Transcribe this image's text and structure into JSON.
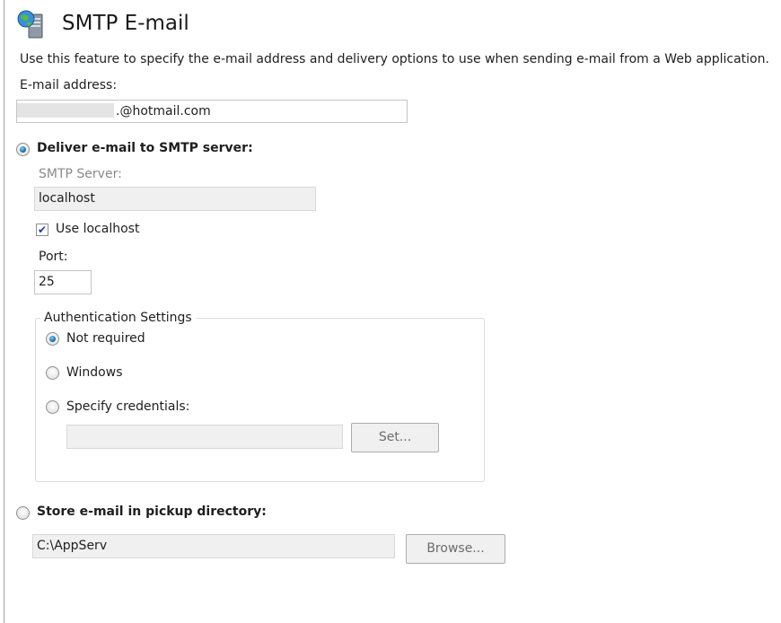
{
  "header": {
    "title": "SMTP E-mail",
    "icon": "globe-server-icon"
  },
  "description": "Use this feature to specify the e-mail address and delivery options to use when sending e-mail from a Web application.",
  "email": {
    "label": "E-mail address:",
    "value_suffix": ".@hotmail.com"
  },
  "smtp": {
    "option_label": "Deliver e-mail to SMTP server:",
    "selected": true,
    "server_label": "SMTP Server:",
    "server_value": "localhost",
    "use_localhost_label": "Use localhost",
    "use_localhost_checked": true,
    "port_label": "Port:",
    "port_value": "25"
  },
  "auth": {
    "legend": "Authentication Settings",
    "options": [
      {
        "label": "Not required",
        "checked": true
      },
      {
        "label": "Windows",
        "checked": false
      },
      {
        "label": "Specify credentials:",
        "checked": false
      }
    ],
    "credentials_value": "",
    "set_button": "Set..."
  },
  "pickup": {
    "option_label": "Store e-mail in pickup directory:",
    "selected": false,
    "directory_value": "C:\\AppServ",
    "browse_button": "Browse..."
  },
  "colors": {
    "accent_radio": "#1f6ea8",
    "disabled_field": "#f0f0f0",
    "group_border": "#d5dfe5"
  }
}
